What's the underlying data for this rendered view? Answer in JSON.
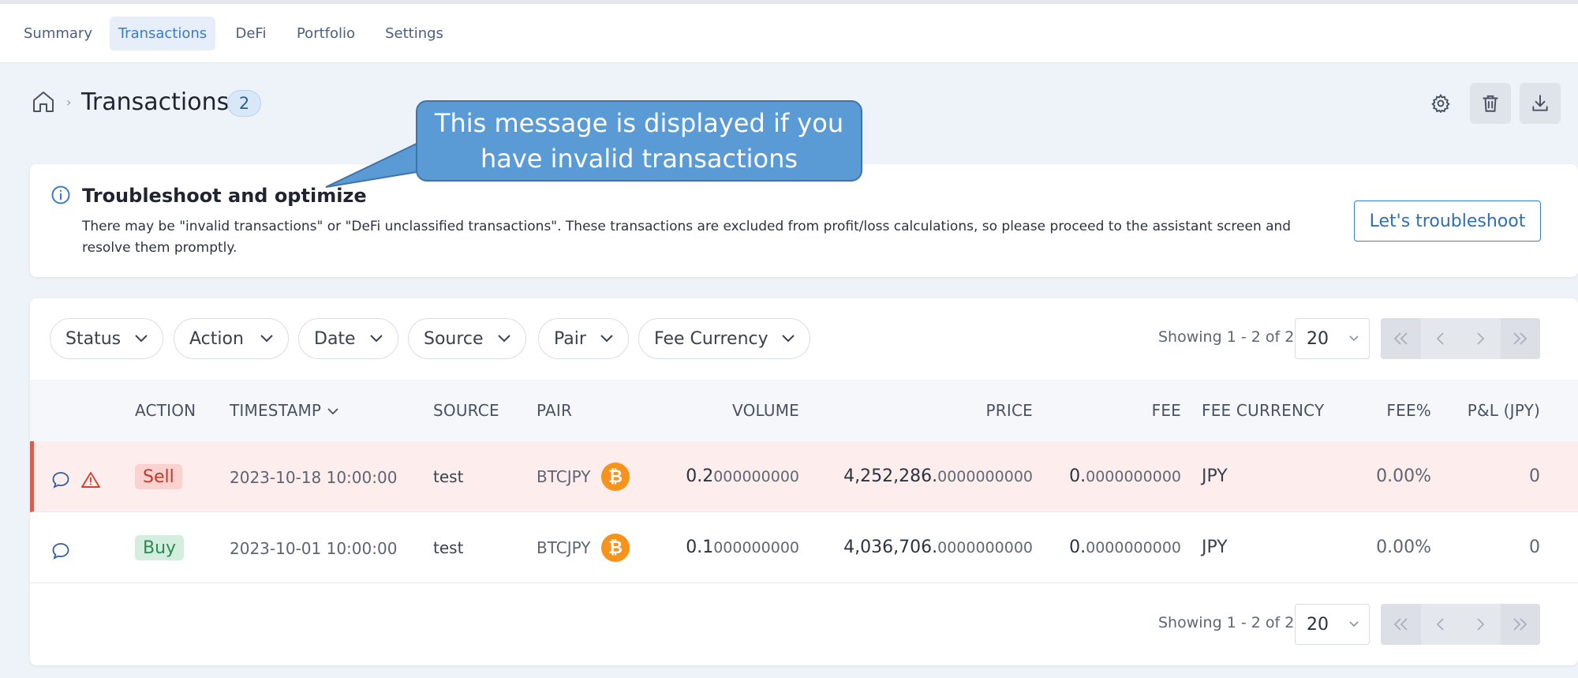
{
  "nav": {
    "tabs": [
      {
        "label": "Summary"
      },
      {
        "label": "Transactions"
      },
      {
        "label": "DeFi"
      },
      {
        "label": "Portfolio"
      },
      {
        "label": "Settings"
      }
    ],
    "active": "Transactions"
  },
  "header": {
    "separator": "›",
    "title": "Transactions",
    "count": "2"
  },
  "callout": {
    "text": "This message is displayed if you have invalid transactions"
  },
  "troubleshoot": {
    "title": "Troubleshoot and optimize",
    "description": "There may be \"invalid transactions\" or \"DeFi unclassified transactions\". These transactions are excluded from profit/loss calculations, so please proceed to the assistant screen and resolve them promptly.",
    "button_label": "Let's troubleshoot"
  },
  "filters": [
    "Status",
    "Action",
    "Date",
    "Source",
    "Pair",
    "Fee Currency"
  ],
  "pagination": {
    "showing": "Showing 1 - 2 of 2",
    "page_size": "20"
  },
  "table": {
    "columns": [
      "ACTION",
      "TIMESTAMP",
      "SOURCE",
      "PAIR",
      "VOLUME",
      "PRICE",
      "FEE",
      "FEE CURRENCY",
      "FEE%",
      "P&L (JPY)"
    ],
    "rows": [
      {
        "status": "invalid",
        "action": "Sell",
        "timestamp": "2023-10-18 10:00:00",
        "source": "test",
        "pair": "BTCJPY",
        "volume_int": "0.2",
        "volume_dec": "000000000",
        "price_int": "4,252,286.",
        "price_dec": "0000000000",
        "fee_int": "0.",
        "fee_dec": "0000000000",
        "fee_currency": "JPY",
        "fee_pct": "0.00%",
        "pnl": "0"
      },
      {
        "status": "valid",
        "action": "Buy",
        "timestamp": "2023-10-01 10:00:00",
        "source": "test",
        "pair": "BTCJPY",
        "volume_int": "0.1",
        "volume_dec": "000000000",
        "price_int": "4,036,706.",
        "price_dec": "0000000000",
        "fee_int": "0.",
        "fee_dec": "0000000000",
        "fee_currency": "JPY",
        "fee_pct": "0.00%",
        "pnl": "0"
      }
    ]
  },
  "icons": {
    "btc_glyph": "₿"
  },
  "colors": {
    "accent": "#3a7cc8",
    "invalid_row": "#fdeeed",
    "invalid_border": "#e05a4e",
    "sell": "#c0392b",
    "buy": "#2e8a52",
    "callout": "#5b9bd5",
    "btc": "#f7931a"
  }
}
